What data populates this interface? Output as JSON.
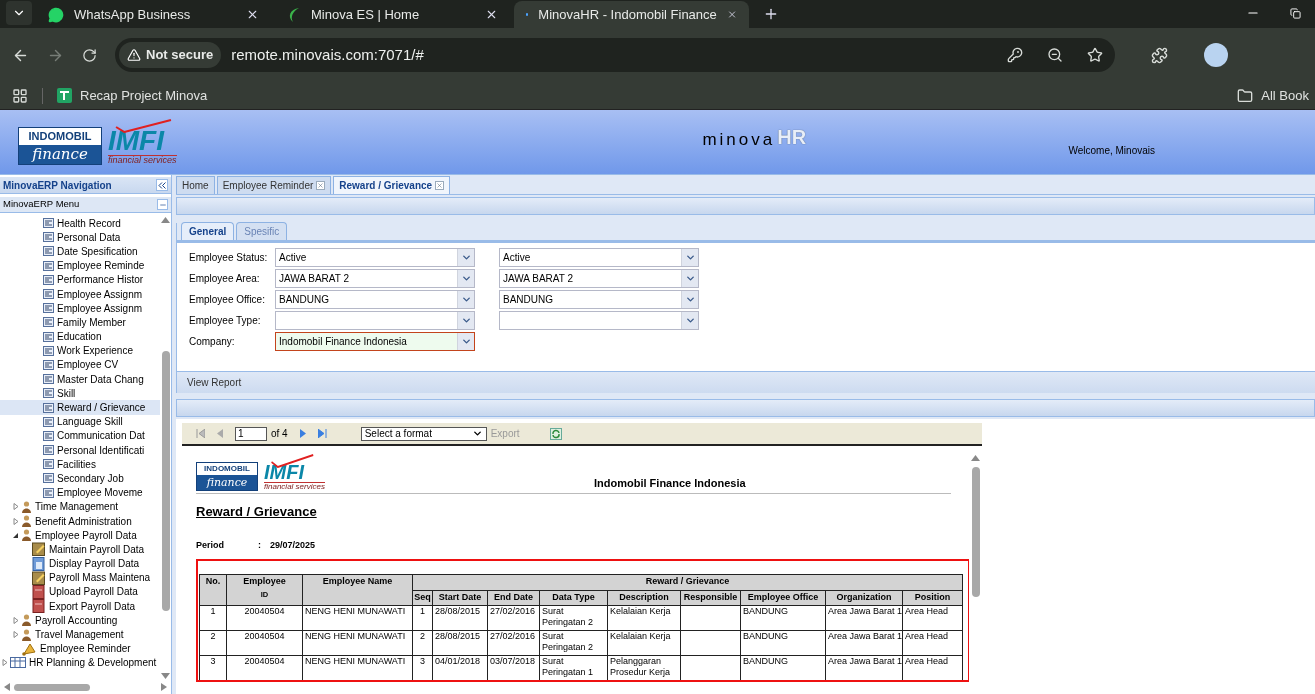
{
  "browser": {
    "tabs": [
      {
        "title": "WhatsApp Business",
        "kind": "chat",
        "selected": false
      },
      {
        "title": "Minova ES | Home",
        "kind": "leaf",
        "selected": false
      },
      {
        "title": "MinovaHR - Indomobil Finance",
        "kind": "dot",
        "selected": true
      }
    ],
    "security": "Not secure",
    "url": "remote.minovais.com:7071/#",
    "bookmarks": [
      "Recap Project Minova"
    ],
    "all_bookmarks": "All Book"
  },
  "header": {
    "logo_top": "INDOMOBIL",
    "logo_bottom": "finance",
    "logo_mark": "IMFI",
    "logo_sub": "financial services",
    "app_name": "minova",
    "app_suffix": "HR",
    "welcome": "Welcome, Minovais"
  },
  "navigation": {
    "title": "MinovaERP Navigation",
    "menu_title": "MinovaERP Menu",
    "tree": [
      {
        "children": [
          {
            "children": [
              {
                "children": [
                  {
                    "label": "Health Record",
                    "kind": "form",
                    "selected": false
                  },
                  {
                    "label": "Personal Data",
                    "kind": "form",
                    "selected": false
                  },
                  {
                    "label": "Date Spesification",
                    "kind": "form",
                    "selected": false
                  },
                  {
                    "label": "Employee Reminde",
                    "kind": "form",
                    "selected": false
                  },
                  {
                    "label": "Performance Histor",
                    "kind": "form",
                    "selected": false
                  },
                  {
                    "label": "Employee Assignm",
                    "kind": "form",
                    "selected": false
                  },
                  {
                    "label": "Employee Assignm",
                    "kind": "form",
                    "selected": false
                  },
                  {
                    "label": "Family Member",
                    "kind": "form",
                    "selected": false
                  },
                  {
                    "label": "Education",
                    "kind": "form",
                    "selected": false
                  },
                  {
                    "label": "Work Experience",
                    "kind": "form",
                    "selected": false
                  },
                  {
                    "label": "Employee CV",
                    "kind": "form",
                    "selected": false
                  },
                  {
                    "label": "Master Data Chang",
                    "kind": "form",
                    "selected": false
                  },
                  {
                    "label": "Skill",
                    "kind": "form",
                    "selected": false
                  },
                  {
                    "label": "Reward / Grievance",
                    "kind": "form",
                    "selected": true
                  },
                  {
                    "label": "Language Skill",
                    "kind": "form",
                    "selected": false
                  },
                  {
                    "label": "Communication Dat",
                    "kind": "form",
                    "selected": false
                  },
                  {
                    "label": "Personal Identificati",
                    "kind": "form",
                    "selected": false
                  },
                  {
                    "label": "Facilities",
                    "kind": "form",
                    "selected": false
                  },
                  {
                    "label": "Secondary Job",
                    "kind": "form",
                    "selected": false
                  },
                  {
                    "label": "Employee Moveme",
                    "kind": "form",
                    "selected": false
                  }
                ]
              }
            ]
          },
          {
            "label": "Time Management",
            "kind": "person",
            "expanded": false,
            "selected": false
          },
          {
            "label": "Benefit Administration",
            "kind": "person",
            "expanded": false,
            "selected": false
          },
          {
            "label": "Employee Payroll Data",
            "kind": "person",
            "expanded": true,
            "selected": false,
            "children": [
              {
                "label": "Maintain Payroll Data",
                "kind": "edit",
                "selected": false
              },
              {
                "label": "Display Payroll Data",
                "kind": "doc",
                "selected": false
              },
              {
                "label": "Payroll Mass Maintena",
                "kind": "edit",
                "selected": false
              },
              {
                "label": "Upload Payroll Data",
                "kind": "book",
                "selected": false
              },
              {
                "label": "Export Payroll Data",
                "kind": "book",
                "selected": false
              }
            ]
          },
          {
            "label": "Payroll Accounting",
            "kind": "person",
            "expanded": false,
            "selected": false
          },
          {
            "label": "Travel Management",
            "kind": "person",
            "expanded": false,
            "selected": false
          },
          {
            "label": "Employee Reminder",
            "kind": "bell",
            "selected": false
          }
        ]
      },
      {
        "label": "HR Planning & Development",
        "kind": "grid",
        "expanded": false,
        "selected": false
      }
    ]
  },
  "tabs": [
    {
      "label": "Home",
      "closable": false,
      "selected": false
    },
    {
      "label": "Employee Reminder",
      "closable": true,
      "selected": false
    },
    {
      "label": "Reward / Grievance",
      "closable": true,
      "selected": true
    }
  ],
  "subtabs": [
    {
      "label": "General",
      "selected": true
    },
    {
      "label": "Spesific",
      "selected": false
    }
  ],
  "filters": [
    {
      "label": "Employee Status:",
      "from": "Active",
      "to": "Active",
      "focused": false
    },
    {
      "label": "Employee Area:",
      "from": "JAWA BARAT 2",
      "to": "JAWA BARAT 2",
      "focused": false
    },
    {
      "label": "Employee Office:",
      "from": "BANDUNG",
      "to": "BANDUNG",
      "focused": false
    },
    {
      "label": "Employee Type:",
      "focused": false
    },
    {
      "label": "Company:",
      "from": "Indomobil Finance Indonesia",
      "focused": true
    }
  ],
  "view_report": "View Report",
  "report": {
    "page": "1",
    "page_count": "of 4",
    "format": "Select a format",
    "export": "Export",
    "logo_top": "INDOMOBIL",
    "logo_bottom": "finance",
    "logo_mark": "IMFI",
    "logo_sub": "financial services",
    "company": "Indomobil Finance Indonesia",
    "title": "Reward / Grievance",
    "period_label": "Period",
    "period_sep": ":",
    "period": "29/07/2025",
    "group_header": "Reward / Grievance",
    "columns": [
      {
        "label": "No."
      },
      {
        "label": "Employee",
        "sublabel": "ID"
      },
      {
        "label": "Employee Name"
      },
      {
        "label": "Seq"
      },
      {
        "label": "Start Date"
      },
      {
        "label": "End Date"
      },
      {
        "label": "Data Type"
      },
      {
        "label": "Description"
      },
      {
        "label": "Responsible"
      },
      {
        "label": "Employee Office"
      },
      {
        "label": "Organization"
      },
      {
        "label": "Position"
      }
    ],
    "rows": [
      [
        "1",
        "20040504",
        "NENG HENI MUNAWATI",
        "1",
        "28/08/2015",
        "27/02/2016",
        "Surat Peringatan 2",
        "Kelalaian Kerja",
        "",
        "BANDUNG",
        "Area Jawa Barat 1",
        "Area Head"
      ],
      [
        "2",
        "20040504",
        "NENG HENI MUNAWATI",
        "2",
        "28/08/2015",
        "27/02/2016",
        "Surat Peringatan 2",
        "Kelalaian Kerja",
        "",
        "BANDUNG",
        "Area Jawa Barat 1",
        "Area Head"
      ],
      [
        "3",
        "20040504",
        "NENG HENI MUNAWATI",
        "3",
        "04/01/2018",
        "03/07/2018",
        "Surat Peringatan 1",
        "Pelanggaran Prosedur Kerja",
        "",
        "BANDUNG",
        "Area Jawa Barat 1",
        "Area Head"
      ]
    ]
  }
}
